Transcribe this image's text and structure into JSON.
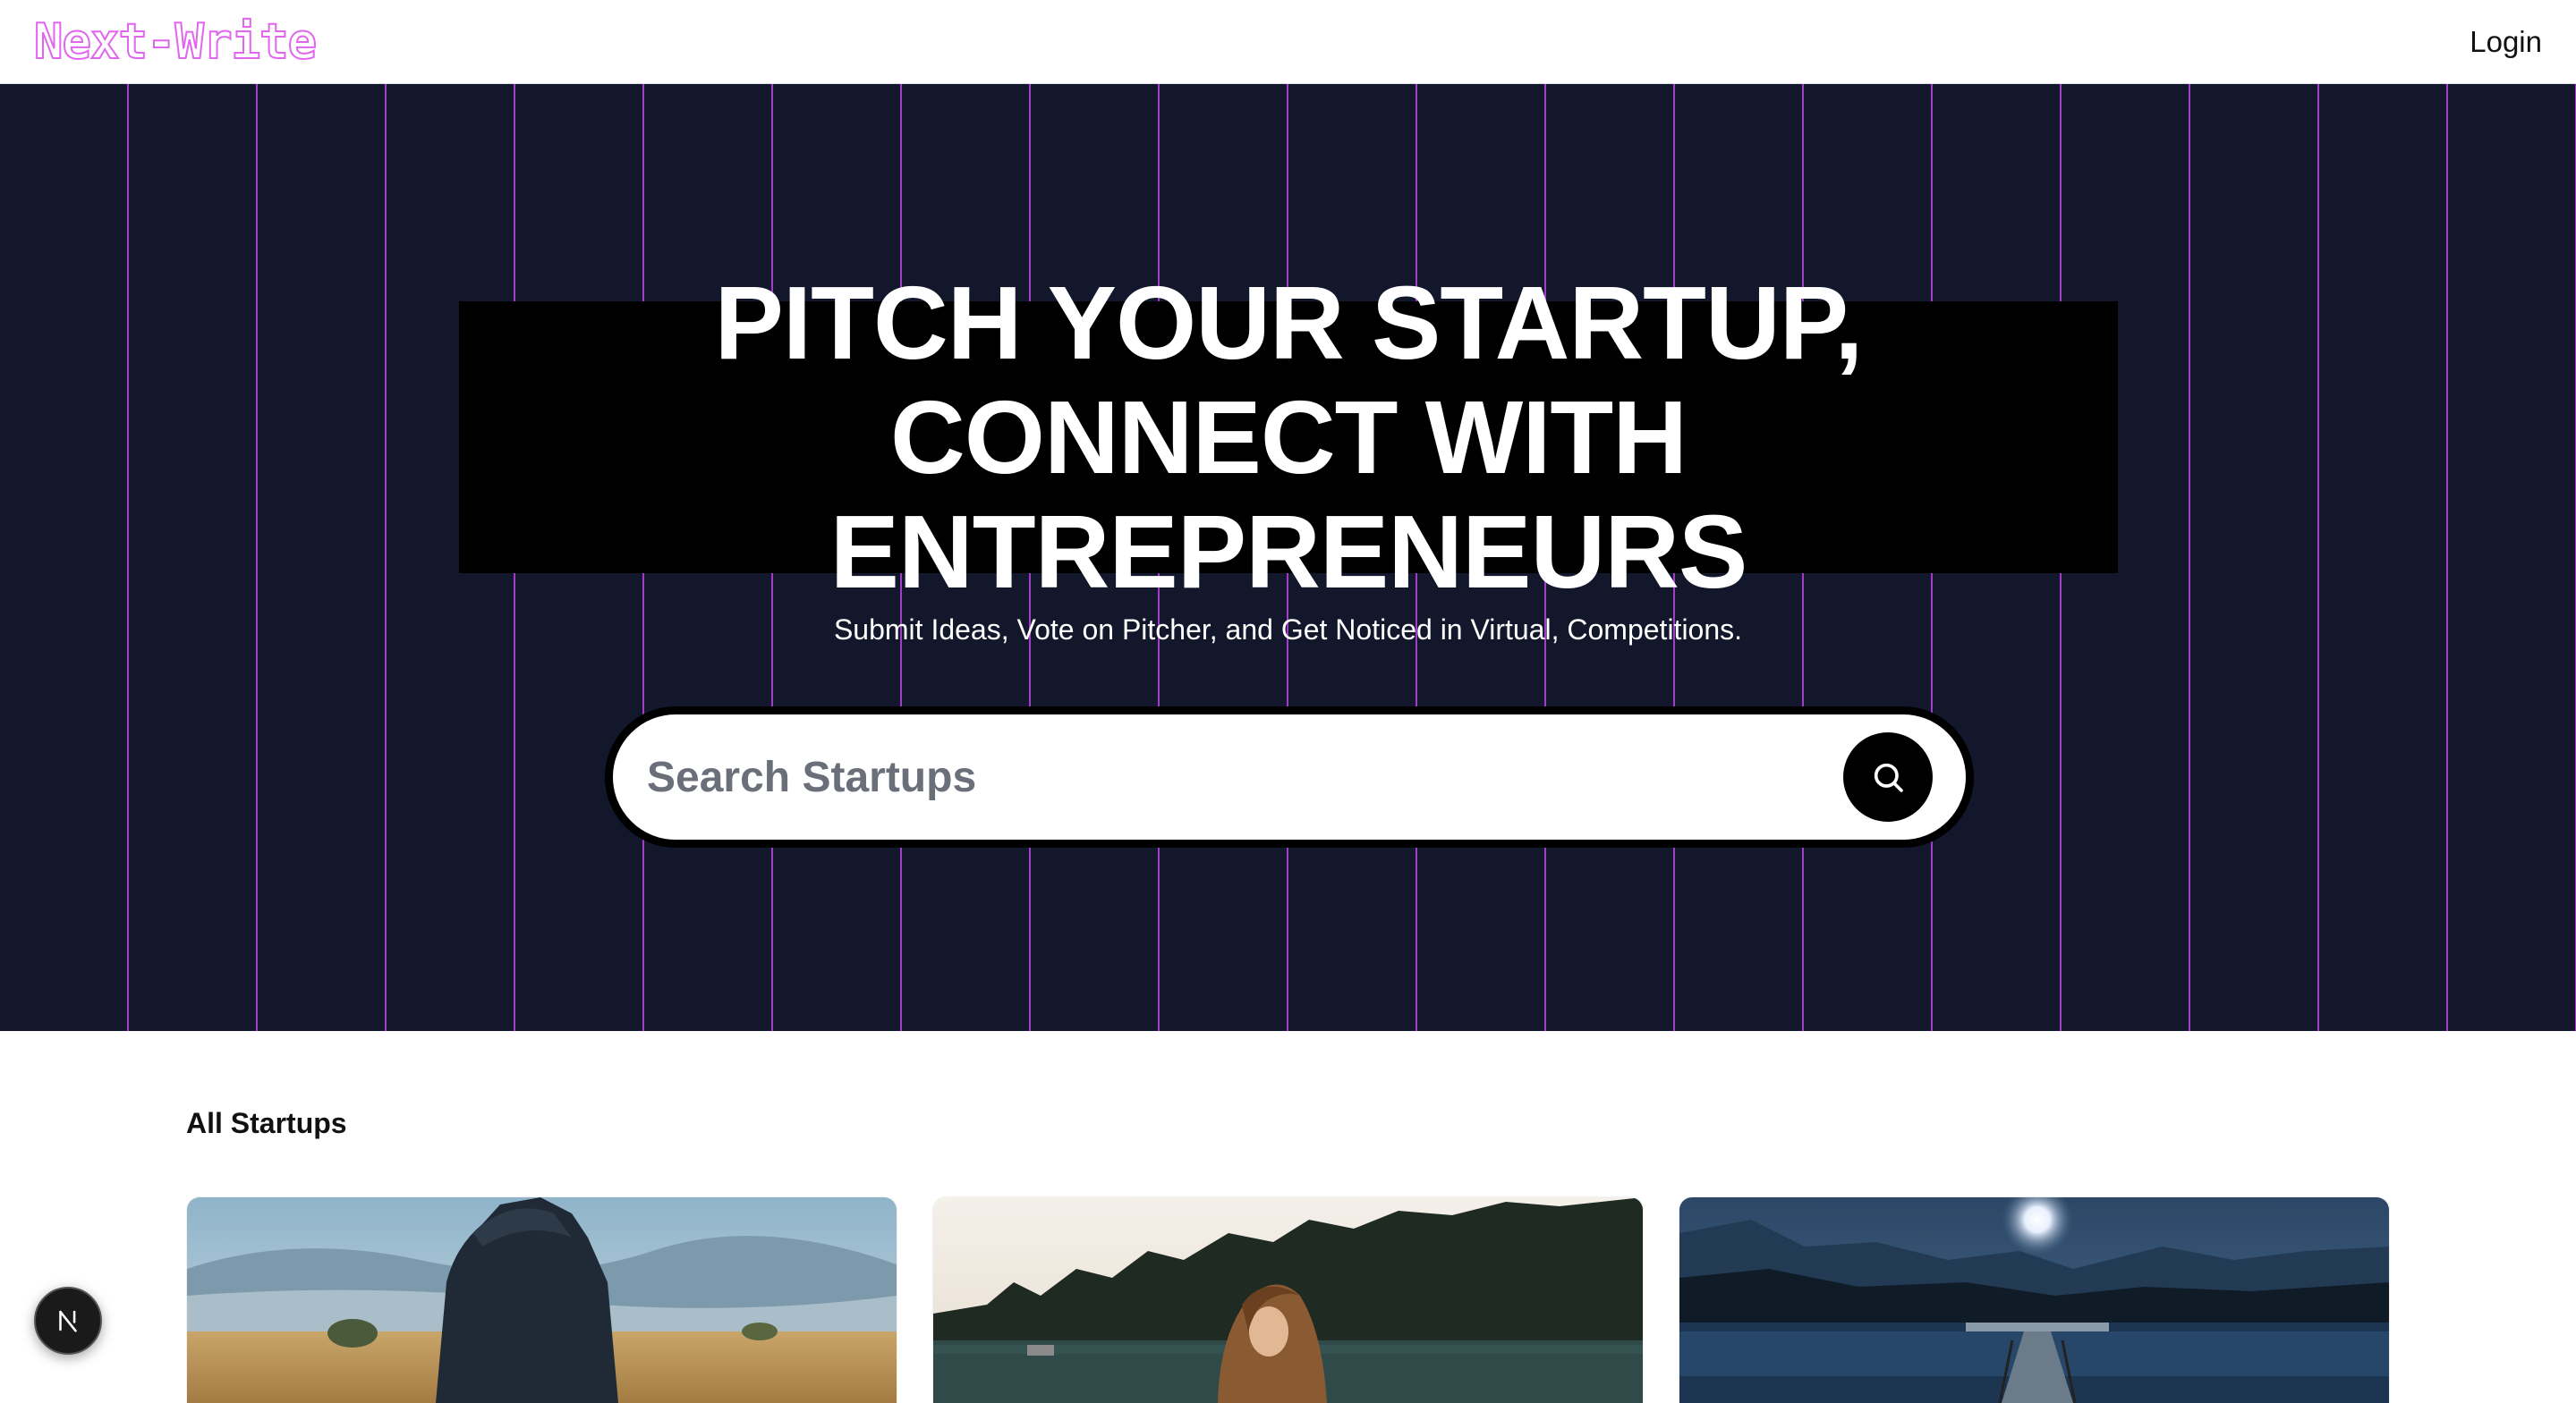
{
  "nav": {
    "brand": "Next-Write",
    "login_label": "Login"
  },
  "hero": {
    "headline_line1": "PITCH YOUR STARTUP,",
    "headline_line2": "CONNECT WITH ENTREPRENEURS",
    "subheadline": "Submit Ideas, Vote on Pitcher, and Get Noticed in Virtual, Competitions."
  },
  "search": {
    "placeholder": "Search Startups",
    "value": ""
  },
  "startups": {
    "section_title": "All Startups"
  },
  "icons": {
    "search": "search-icon",
    "nextjs": "nextjs-logo-icon"
  },
  "colors": {
    "brand_outline": "#e066ee",
    "hero_background": "#12172b",
    "hero_stripes": "#a23cc9",
    "headline_box": "#000000"
  }
}
